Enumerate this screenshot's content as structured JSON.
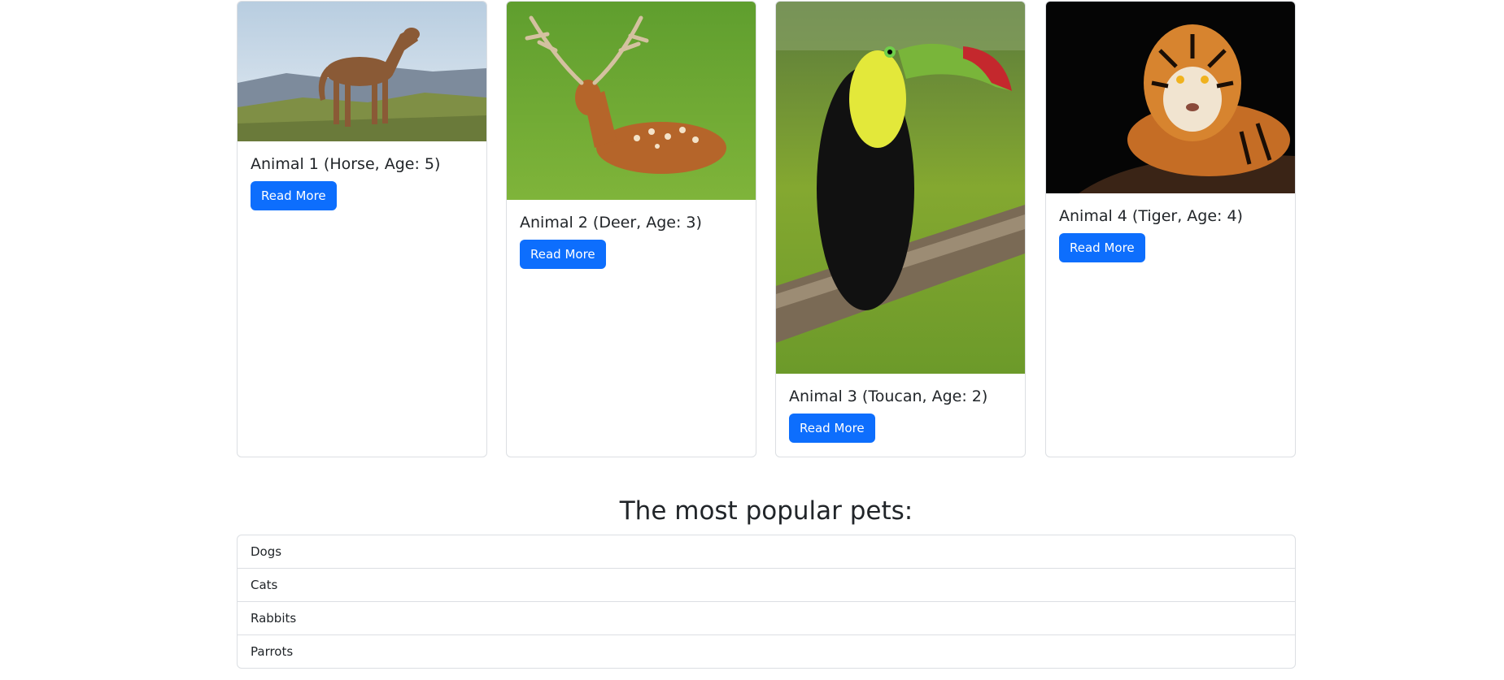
{
  "cards": [
    {
      "title": "Animal 1 (Horse, Age: 5)",
      "button_label": "Read More",
      "image": "horse-photo"
    },
    {
      "title": "Animal 2 (Deer, Age: 3)",
      "button_label": "Read More",
      "image": "deer-photo"
    },
    {
      "title": "Animal 3 (Toucan, Age: 2)",
      "button_label": "Read More",
      "image": "toucan-photo"
    },
    {
      "title": "Animal 4 (Tiger, Age: 4)",
      "button_label": "Read More",
      "image": "tiger-photo"
    }
  ],
  "popular_pets": {
    "heading": "The most popular pets:",
    "items": [
      "Dogs",
      "Cats",
      "Rabbits",
      "Parrots"
    ]
  },
  "colors": {
    "button": "#0d6efd",
    "border": "#dcdfe3",
    "text": "#212529"
  }
}
